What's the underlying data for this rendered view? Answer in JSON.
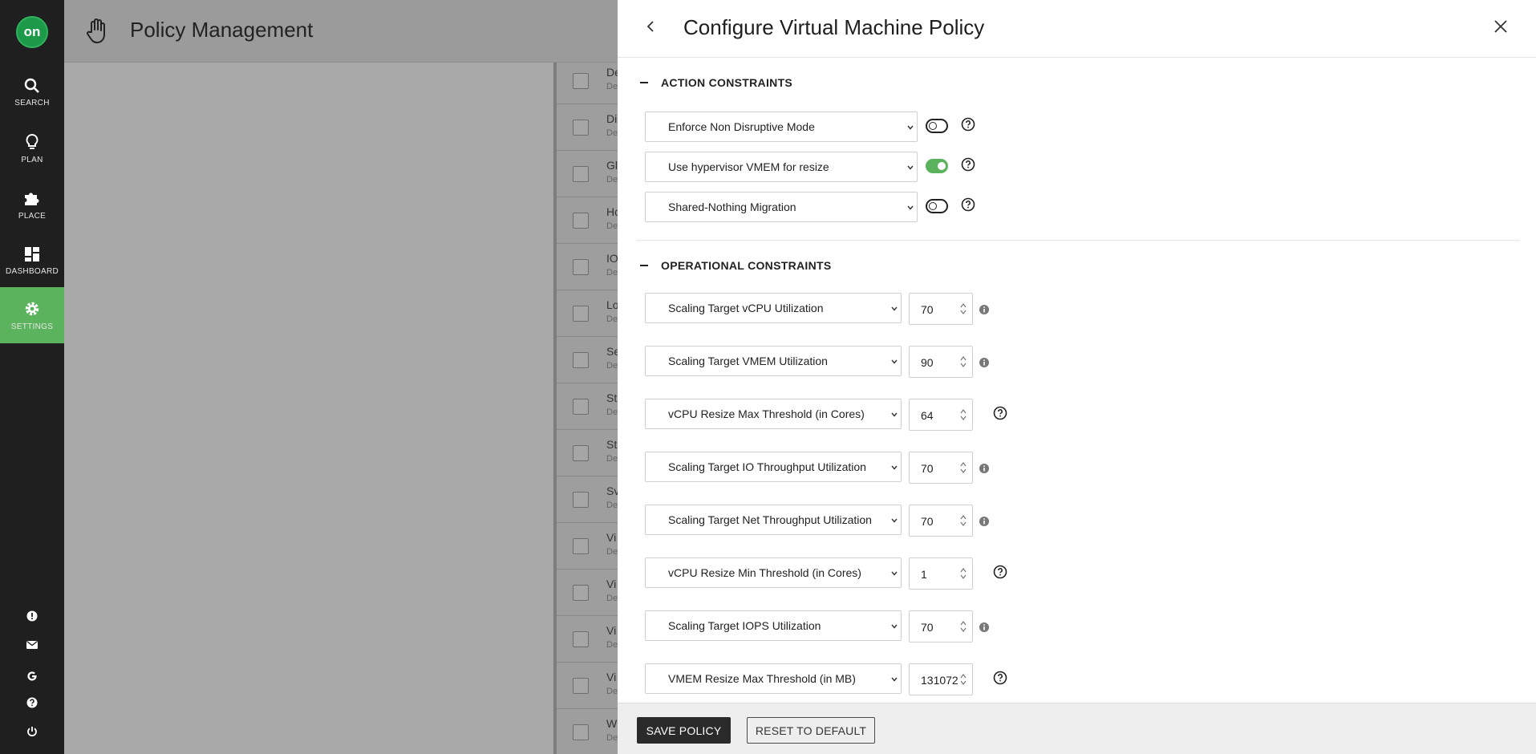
{
  "nav": {
    "logo": "on",
    "items": [
      {
        "label": "SEARCH",
        "icon": "search-icon"
      },
      {
        "label": "PLAN",
        "icon": "lightbulb-icon"
      },
      {
        "label": "PLACE",
        "icon": "puzzle-icon"
      },
      {
        "label": "DASHBOARD",
        "icon": "dashboard-icon"
      },
      {
        "label": "SETTINGS",
        "icon": "gear-icon",
        "active": true
      }
    ],
    "bottom_icons": [
      "alert-icon",
      "mail-icon",
      "google-icon",
      "help-icon",
      "power-icon"
    ],
    "active_color": "#5cb35e"
  },
  "background_page": {
    "title": "Policy Management",
    "rows": [
      {
        "name": "De",
        "sub": "De"
      },
      {
        "name": "Di",
        "sub": "De"
      },
      {
        "name": "Gl",
        "sub": "De"
      },
      {
        "name": "Ho",
        "sub": "De"
      },
      {
        "name": "IO",
        "sub": "De"
      },
      {
        "name": "Lo",
        "sub": "De"
      },
      {
        "name": "Se",
        "sub": "De"
      },
      {
        "name": "St",
        "sub": "De"
      },
      {
        "name": "St",
        "sub": "De"
      },
      {
        "name": "Sv",
        "sub": "De"
      },
      {
        "name": "Vi",
        "sub": "De"
      },
      {
        "name": "Vi",
        "sub": "De"
      },
      {
        "name": "Vi",
        "sub": "De"
      },
      {
        "name": "Vi",
        "sub": "De"
      },
      {
        "name": "W",
        "sub": "De"
      }
    ]
  },
  "panel": {
    "title": "Configure Virtual Machine Policy",
    "action_section": {
      "title": "ACTION CONSTRAINTS",
      "items": [
        {
          "label": "Enforce Non Disruptive Mode",
          "enabled": false
        },
        {
          "label": "Use hypervisor VMEM for resize",
          "enabled": true
        },
        {
          "label": "Shared-Nothing Migration",
          "enabled": false
        }
      ]
    },
    "operational_section": {
      "title": "OPERATIONAL CONSTRAINTS",
      "items": [
        {
          "label": "Scaling Target vCPU Utilization",
          "value": "70",
          "hint": "info"
        },
        {
          "label": "Scaling Target VMEM Utilization",
          "value": "90",
          "hint": "info"
        },
        {
          "label": "vCPU Resize Max Threshold (in Cores)",
          "value": "64",
          "hint": "help"
        },
        {
          "label": "Scaling Target IO Throughput Utilization",
          "value": "70",
          "hint": "info"
        },
        {
          "label": "Scaling Target Net Throughput Utilization",
          "value": "70",
          "hint": "info"
        },
        {
          "label": "vCPU Resize Min Threshold (in Cores)",
          "value": "1",
          "hint": "help"
        },
        {
          "label": "Scaling Target IOPS Utilization",
          "value": "70",
          "hint": "info"
        },
        {
          "label": "VMEM Resize Max Threshold (in MB)",
          "value": "131072",
          "hint": "help"
        }
      ]
    },
    "footer": {
      "save_label": "SAVE POLICY",
      "reset_label": "RESET TO DEFAULT"
    }
  }
}
